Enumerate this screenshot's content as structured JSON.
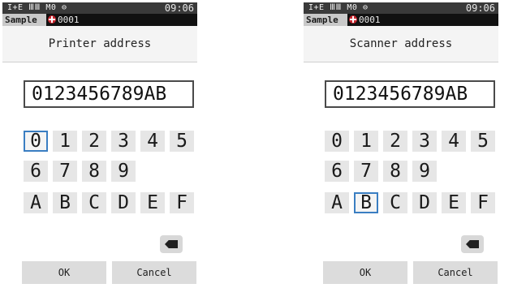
{
  "colors": {
    "accent": "#3a7ec2",
    "target": "#c8262f"
  },
  "keys": [
    "0",
    "1",
    "2",
    "3",
    "4",
    "5",
    "6",
    "7",
    "8",
    "9",
    "A",
    "B",
    "C",
    "D",
    "E",
    "F"
  ],
  "screens": [
    {
      "status": {
        "icons": "I+E ⅢⅢ M0 ⊖",
        "time": "09:06"
      },
      "tab": {
        "label": "Sample",
        "number": "0001"
      },
      "title": "Printer address",
      "field_value": "0123456789AB",
      "selected_key": "0",
      "ok_label": "OK",
      "cancel_label": "Cancel",
      "backspace_icon": "backspace-icon"
    },
    {
      "status": {
        "icons": "I+E ⅢⅢ M0 ⊖",
        "time": "09:06"
      },
      "tab": {
        "label": "Sample",
        "number": "0001"
      },
      "title": "Scanner address",
      "field_value": "0123456789AB",
      "selected_key": "B",
      "ok_label": "OK",
      "cancel_label": "Cancel",
      "backspace_icon": "backspace-icon"
    }
  ]
}
